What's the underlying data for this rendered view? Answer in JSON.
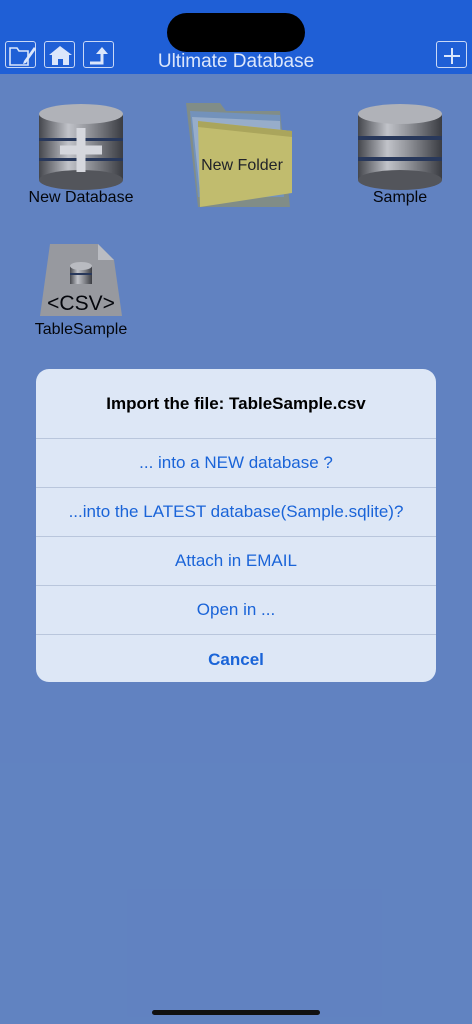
{
  "navbar": {
    "title": "Ultimate Database",
    "icons": [
      "folder-edit-icon",
      "home-icon",
      "up-arrow-icon",
      "add-folder-icon"
    ]
  },
  "files": [
    {
      "label": "New Database",
      "icon": "database-add-icon"
    },
    {
      "label": "New Folder",
      "icon": "folder-icon"
    },
    {
      "label": "Sample",
      "icon": "database-icon"
    },
    {
      "label": "TableSample",
      "icon": "csv-file-icon",
      "badge": "<CSV>"
    }
  ],
  "dialog": {
    "title": "Import the file: TableSample.csv",
    "actions": [
      "... into a NEW database ?",
      "...into the LATEST database(Sample.sqlite)?",
      "Attach in EMAIL",
      "Open in ...",
      "Cancel"
    ]
  },
  "colors": {
    "background": "#6a8ece",
    "navbar": "#1f5fd6",
    "action_blue": "#1a64d8"
  }
}
